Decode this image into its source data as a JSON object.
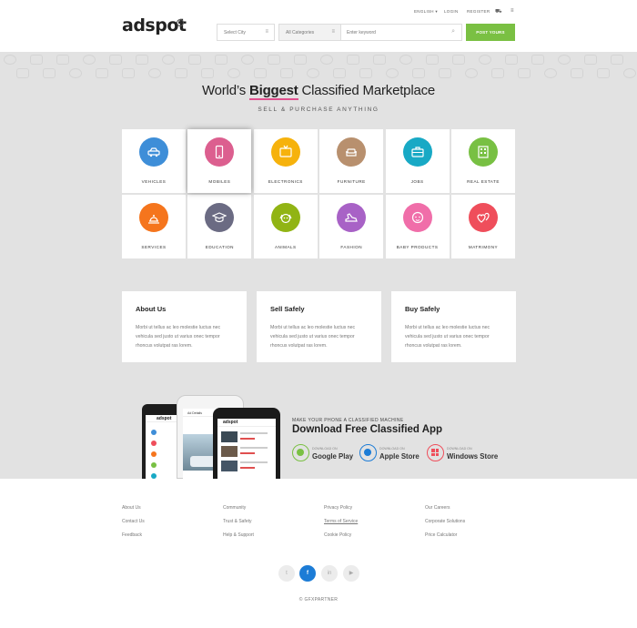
{
  "header": {
    "logo_part1": "ad",
    "logo_part2": "spot",
    "topnav": {
      "language": "ENGLISH ▾",
      "login": "LOGIN",
      "register": "REGISTER"
    },
    "city_placeholder": "Select City",
    "category_selected": "All Categories",
    "keyword_placeholder": "Enter keyword",
    "post_label": "POST YOURS"
  },
  "hero": {
    "title_prefix": "World’s ",
    "title_bold": "Biggest",
    "title_suffix": " Classified Marketplace",
    "subtitle": "SELL & PURCHASE ANYTHING"
  },
  "categories": [
    {
      "label": "VEHICLES",
      "color": "#3e8ed8",
      "icon": "car-icon"
    },
    {
      "label": "MOBILES",
      "color": "#dc5f8f",
      "icon": "mobile-icon"
    },
    {
      "label": "ELECTRONICS",
      "color": "#f6b20c",
      "icon": "tv-icon"
    },
    {
      "label": "FURNITURE",
      "color": "#b8906e",
      "icon": "sofa-icon"
    },
    {
      "label": "JOBS",
      "color": "#18a9c5",
      "icon": "briefcase-icon"
    },
    {
      "label": "REAL ESTATE",
      "color": "#78c043",
      "icon": "building-icon"
    },
    {
      "label": "SERVICES",
      "color": "#f5751d",
      "icon": "bell-icon"
    },
    {
      "label": "EDUCATION",
      "color": "#6b6b83",
      "icon": "graduation-cap-icon"
    },
    {
      "label": "ANIMALS",
      "color": "#91b414",
      "icon": "dog-icon"
    },
    {
      "label": "FASHION",
      "color": "#a862c6",
      "icon": "shoe-icon"
    },
    {
      "label": "BABY PRODUCTS",
      "color": "#f06ea9",
      "icon": "baby-icon"
    },
    {
      "label": "MATRIMONY",
      "color": "#ef4e5b",
      "icon": "hearts-icon"
    }
  ],
  "info_boxes": [
    {
      "title": "About Us",
      "text": "Morbi ut tellus ac leo molestie luctus nec vehicula sed justo ut varius onec tempor rhoncus volutpat ras lorem."
    },
    {
      "title": "Sell Safely",
      "text": "Morbi ut tellus ac leo molestie luctus nec vehicula sed justo ut varius onec tempor rhoncus volutpat ras lorem."
    },
    {
      "title": "Buy Safely",
      "text": "Morbi ut tellus ac leo molestie luctus nec vehicula sed justo ut varius onec tempor rhoncus volutpat ras lorem."
    }
  ],
  "app": {
    "kicker": "MAKE YOUR PHONE A CLASSIFIED MACHINE",
    "title": "Download Free Classified App",
    "stores": [
      {
        "small": "DOWNLOAD ON",
        "name": "Google Play",
        "color": "#7ac043"
      },
      {
        "small": "DOWNLOAD ON",
        "name": "Apple Store",
        "color": "#1c7cd6"
      },
      {
        "small": "DOWNLOAD ON",
        "name": "Windows Store",
        "color": "#ef4e5b"
      }
    ],
    "phone_logo": "adspot",
    "phone_header": "Ad Details"
  },
  "footer": {
    "columns": [
      [
        "About Us",
        "Contact Us",
        "Feedback"
      ],
      [
        "Community",
        "Trust & Safety",
        "Help & Support"
      ],
      [
        "Privacy Policy",
        "Terms of Service",
        "Cookie Policy"
      ],
      [
        "Our Careers",
        "Corporate Solutions",
        "Price Calculator"
      ]
    ],
    "social": [
      "twitter-icon",
      "facebook-icon",
      "linkedin-icon",
      "youtube-icon"
    ],
    "social_glyphs": [
      "t",
      "f",
      "in",
      "▶"
    ],
    "copyright": "© GFXPARTNER"
  }
}
